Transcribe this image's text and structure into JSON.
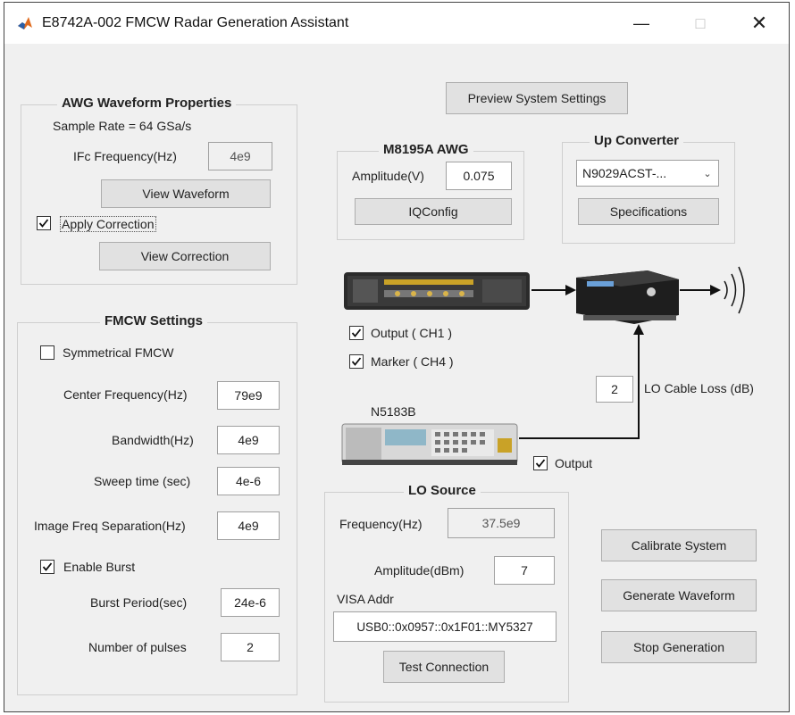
{
  "window": {
    "title": "E8742A-002 FMCW Radar Generation Assistant",
    "minimize": "—",
    "maximize": "□",
    "close": "✕"
  },
  "preview_button": "Preview System Settings",
  "awg_props": {
    "title": "AWG Waveform Properties",
    "sample_rate": "Sample Rate = 64 GSa/s",
    "ifc_label": "IFc Frequency(Hz)",
    "ifc_value": "4e9",
    "view_waveform": "View Waveform",
    "apply_correction": "Apply Correction",
    "apply_correction_checked": true,
    "view_correction": "View Correction"
  },
  "fmcw": {
    "title": "FMCW Settings",
    "symmetrical": "Symmetrical FMCW",
    "symmetrical_checked": false,
    "center_label": "Center Frequency(Hz)",
    "center_value": "79e9",
    "bandwidth_label": "Bandwidth(Hz)",
    "bandwidth_value": "4e9",
    "sweep_label": "Sweep time (sec)",
    "sweep_value": "4e-6",
    "image_label": "Image Freq Separation(Hz)",
    "image_value": "4e9",
    "enable_burst": "Enable Burst",
    "enable_burst_checked": true,
    "burst_period_label": "Burst Period(sec)",
    "burst_period_value": "24e-6",
    "pulses_label": "Number of pulses",
    "pulses_value": "2"
  },
  "m8195a": {
    "title": "M8195A AWG",
    "amplitude_label": "Amplitude(V)",
    "amplitude_value": "0.075",
    "iqconfig": "IQConfig"
  },
  "upconverter": {
    "title": "Up Converter",
    "model": "N9029ACST-...",
    "specifications": "Specifications"
  },
  "diagram": {
    "output_ch1": "Output ( CH1 )",
    "output_ch1_checked": true,
    "marker_ch4": "Marker ( CH4 )",
    "marker_ch4_checked": true,
    "lo_loss_value": "2",
    "lo_loss_label": "LO Cable Loss (dB)",
    "siggen_name": "N5183B",
    "output_label": "Output",
    "output_checked": true
  },
  "lo_source": {
    "title": "LO Source",
    "freq_label": "Frequency(Hz)",
    "freq_value": "37.5e9",
    "amp_label": "Amplitude(dBm)",
    "amp_value": "7",
    "visa_label": "VISA Addr",
    "visa_value": "USB0::0x0957::0x1F01::MY5327",
    "test_connection": "Test Connection"
  },
  "actions": {
    "calibrate": "Calibrate System",
    "generate": "Generate Waveform",
    "stop": "Stop Generation"
  },
  "colors": {
    "window_bg": "#f0f0f0",
    "button_bg": "#e1e1e1",
    "matlab_orange": "#e06b1f",
    "matlab_blue": "#2a5fa8"
  }
}
